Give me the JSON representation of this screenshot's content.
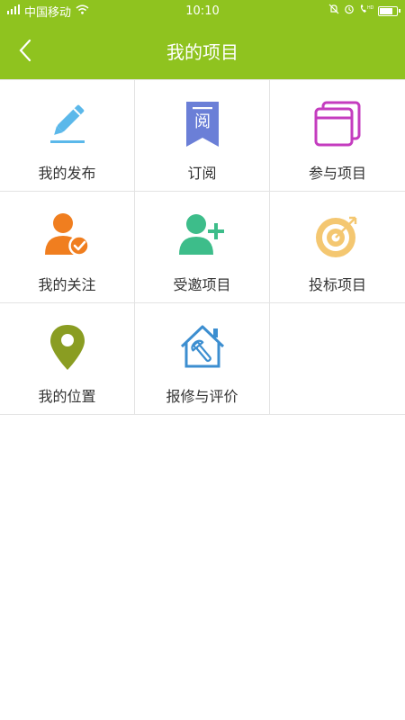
{
  "status_bar": {
    "carrier": "中国移动",
    "time": "10:10"
  },
  "header": {
    "title": "我的项目"
  },
  "grid": [
    {
      "label": "我的发布",
      "icon": "pencil-icon",
      "color": "#5bb8ea"
    },
    {
      "label": "订阅",
      "icon": "subscribe-bookmark-icon",
      "icon_text": "阅",
      "color": "#6b7fd7"
    },
    {
      "label": "参与项目",
      "icon": "windows-icon",
      "color": "#c43cbf"
    },
    {
      "label": "我的关注",
      "icon": "user-check-icon",
      "color": "#f07e1f"
    },
    {
      "label": "受邀项目",
      "icon": "user-add-icon",
      "color": "#3dbd8a"
    },
    {
      "label": "投标项目",
      "icon": "target-icon",
      "color": "#f4c771"
    },
    {
      "label": "我的位置",
      "icon": "location-pin-icon",
      "color": "#8a9d22"
    },
    {
      "label": "报修与评价",
      "icon": "house-wrench-icon",
      "color": "#3c8ed0"
    }
  ],
  "colors": {
    "brand": "#8fc31f",
    "divider": "#e3e3e3",
    "text": "#333333"
  },
  "battery_level": 0.7
}
